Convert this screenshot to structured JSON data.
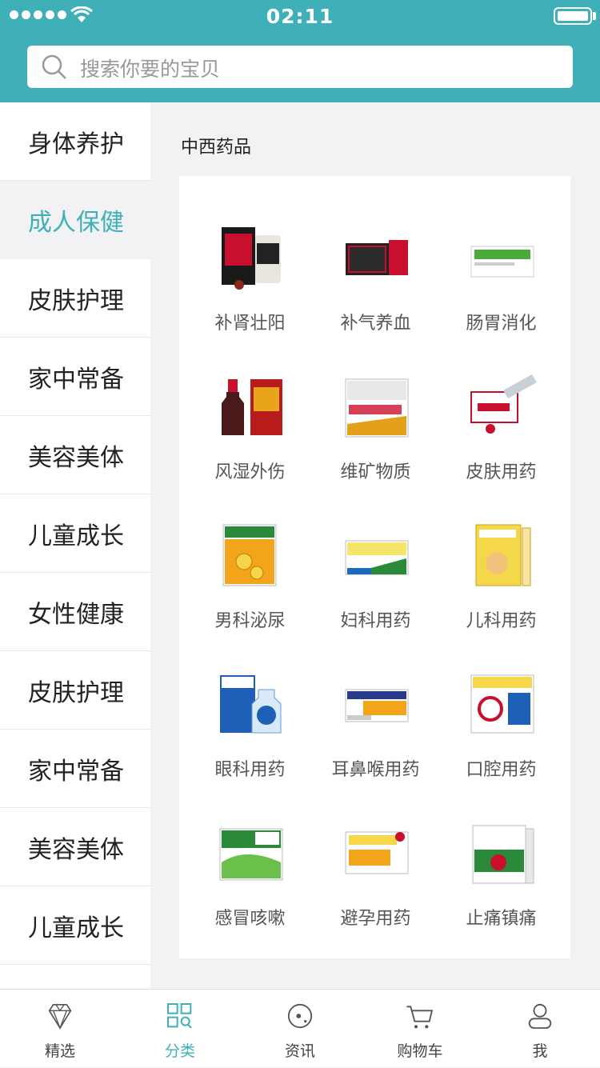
{
  "status_bar": {
    "time": "02:11"
  },
  "search": {
    "placeholder": "搜索你要的宝贝"
  },
  "sidebar": {
    "items": [
      {
        "label": "身体养护",
        "active": false
      },
      {
        "label": "成人保健",
        "active": true
      },
      {
        "label": "皮肤护理",
        "active": false
      },
      {
        "label": "家中常备",
        "active": false
      },
      {
        "label": "美容美体",
        "active": false
      },
      {
        "label": "儿童成长",
        "active": false
      },
      {
        "label": "女性健康",
        "active": false
      },
      {
        "label": "皮肤护理",
        "active": false
      },
      {
        "label": "家中常备",
        "active": false
      },
      {
        "label": "美容美体",
        "active": false
      },
      {
        "label": "儿童成长",
        "active": false
      }
    ]
  },
  "content": {
    "section_title": "中西药品",
    "products": [
      {
        "label": "补肾壮阳",
        "icon": "kidney-tonic-box-icon"
      },
      {
        "label": "补气养血",
        "icon": "ejiao-box-icon"
      },
      {
        "label": "肠胃消化",
        "icon": "digestion-box-icon"
      },
      {
        "label": "风湿外伤",
        "icon": "medicinal-wine-icon"
      },
      {
        "label": "维矿物质",
        "icon": "centrum-box-icon"
      },
      {
        "label": "皮肤用药",
        "icon": "ointment-tube-icon"
      },
      {
        "label": "男科泌尿",
        "icon": "urology-box-icon"
      },
      {
        "label": "妇科用药",
        "icon": "gynecology-box-icon"
      },
      {
        "label": "儿科用药",
        "icon": "pediatric-box-icon"
      },
      {
        "label": "眼科用药",
        "icon": "eye-drops-icon"
      },
      {
        "label": "耳鼻喉用药",
        "icon": "throat-granules-icon"
      },
      {
        "label": "口腔用药",
        "icon": "oral-care-box-icon"
      },
      {
        "label": "感冒咳嗽",
        "icon": "cold-granules-icon"
      },
      {
        "label": "避孕用药",
        "icon": "contraceptive-box-icon"
      },
      {
        "label": "止痛镇痛",
        "icon": "painkiller-box-icon"
      }
    ]
  },
  "tabbar": {
    "tabs": [
      {
        "label": "精选",
        "icon": "diamond-icon",
        "active": false
      },
      {
        "label": "分类",
        "icon": "category-grid-icon",
        "active": true
      },
      {
        "label": "资讯",
        "icon": "news-compass-icon",
        "active": false
      },
      {
        "label": "购物车",
        "icon": "cart-icon",
        "active": false
      },
      {
        "label": "我",
        "icon": "user-icon",
        "active": false
      }
    ]
  },
  "colors": {
    "accent": "#3fb0b8",
    "background": "#f2f2f4"
  }
}
